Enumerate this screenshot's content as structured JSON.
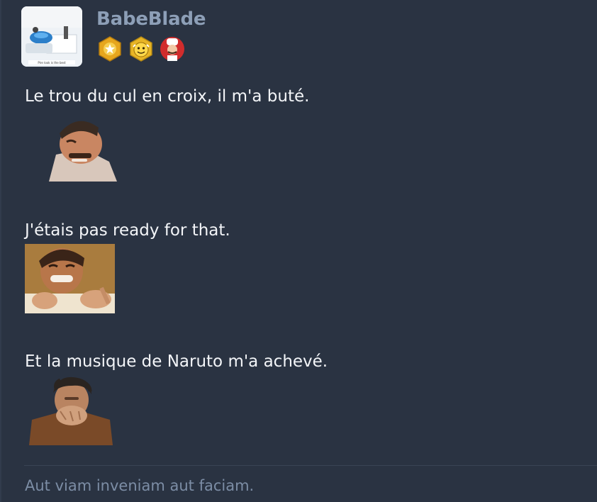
{
  "author": {
    "username": "BabeBlade",
    "avatar_caption": "Pire look is the best",
    "badges": [
      "star-badge-icon",
      "smiley-badge-icon",
      "chef-badge-icon"
    ]
  },
  "messages": [
    {
      "text": "Le trou du cul en croix, il m'a buté.",
      "sticker": "risitas-laughing-sticker"
    },
    {
      "text": "J'étais pas ready for that.",
      "sticker": "laughing-clapping-man-sticker"
    },
    {
      "text": "Et la musique de Naruto m'a achevé.",
      "sticker": "man-laughing-into-hands-sticker"
    }
  ],
  "signature": "Aut viam inveniam aut faciam.",
  "colors": {
    "background": "#2a3342",
    "username": "#8d9fb7",
    "text": "#f3f5f8",
    "signature": "#7c8da5"
  }
}
